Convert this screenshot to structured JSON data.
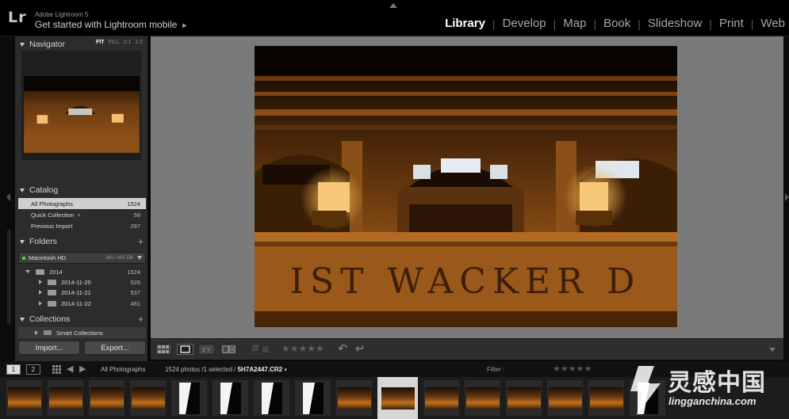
{
  "header": {
    "logo": "Lr",
    "app_name": "Adobe Lightroom 5",
    "mobile_link": "Get started with Lightroom mobile",
    "modules": [
      {
        "label": "Library",
        "active": true
      },
      {
        "label": "Develop",
        "active": false
      },
      {
        "label": "Map",
        "active": false
      },
      {
        "label": "Book",
        "active": false
      },
      {
        "label": "Slideshow",
        "active": false
      },
      {
        "label": "Print",
        "active": false
      },
      {
        "label": "Web",
        "active": false
      }
    ],
    "separator": "|"
  },
  "left_panel": {
    "navigator": {
      "title": "Navigator",
      "zooms": [
        "FIT",
        "FILL",
        "1:1",
        "1:2"
      ],
      "active_zoom": "FIT"
    },
    "catalog": {
      "title": "Catalog",
      "items": [
        {
          "label": "All Photographs",
          "count": "1524",
          "selected": true
        },
        {
          "label": "Quick Collection",
          "suffix": "+",
          "count": "58"
        },
        {
          "label": "Previous Import",
          "count": "297"
        }
      ]
    },
    "folders": {
      "title": "Folders",
      "plus": "+",
      "disk": {
        "name": "Macintosh HD",
        "space": "160 / 465 GB"
      },
      "items": [
        {
          "label": "2014",
          "count": "1524"
        },
        {
          "label": "2014-11-20",
          "count": "526"
        },
        {
          "label": "2014-11-21",
          "count": "537"
        },
        {
          "label": "2014-11-22",
          "count": "461"
        }
      ]
    },
    "collections": {
      "title": "Collections",
      "plus": "+",
      "items": [
        {
          "label": "Smart Collections"
        }
      ]
    },
    "import_label": "Import...",
    "export_label": "Export..."
  },
  "main_photo": {
    "engraved_text": "IST WACKER D"
  },
  "toolbar": {
    "view_icons": [
      "grid-view-icon",
      "loupe-view-icon",
      "compare-view-icon",
      "survey-view-icon"
    ],
    "active_view": "loupe-view-icon",
    "stars": "★★★★★",
    "rotate_left": "↶",
    "rotate_right": "↵"
  },
  "filmstrip_bar": {
    "screen1": "1",
    "screen2": "2",
    "source": "All Photographs",
    "count_text": "1524 photos /1 selected /",
    "file_name": "5H7A2447.CR2",
    "filter_label": "Filter :",
    "filter_stars": "★★★★★"
  },
  "filmstrip": {
    "thumbs": [
      "land",
      "land",
      "land",
      "land",
      "port",
      "port",
      "port",
      "port",
      "land",
      "land",
      "land",
      "land",
      "land",
      "land",
      "land",
      "port"
    ],
    "selected_index": 9
  },
  "watermark": {
    "chinese": "灵感中国",
    "url": "lingganchina.com"
  },
  "colors": {
    "panel": "#2c2c2c",
    "main_bg": "#7a7a7a",
    "photo_warm": "#c6701c",
    "active_module": "#ffffff"
  }
}
